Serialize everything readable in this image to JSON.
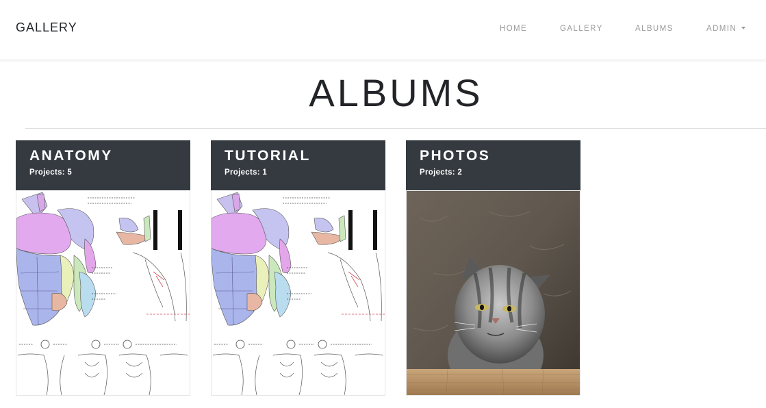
{
  "navbar": {
    "brand": "GALLERY",
    "items": [
      {
        "label": "HOME"
      },
      {
        "label": "GALLERY"
      },
      {
        "label": "ALBUMS"
      },
      {
        "label": "ADMIN"
      }
    ]
  },
  "page": {
    "title": "ALBUMS"
  },
  "albums": [
    {
      "title": "ANATOMY",
      "projects": "Projects: 5",
      "thumbnail": "anatomy-sketch"
    },
    {
      "title": "TUTORIAL",
      "projects": "Projects: 1",
      "thumbnail": "anatomy-sketch"
    },
    {
      "title": "PHOTOS",
      "projects": "Projects: 2",
      "thumbnail": "cat-photo"
    }
  ],
  "colors": {
    "card_header": "#343a40",
    "nav_text": "#9a9a9a",
    "title_text": "#222428"
  }
}
